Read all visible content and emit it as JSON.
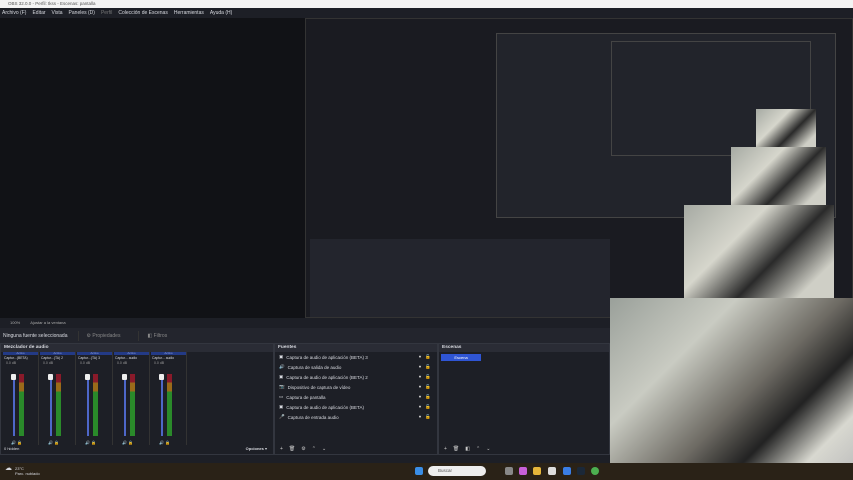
{
  "window_title": "OBS 32.0.0 - Perfil: tkss - Escenas: pantalla",
  "menu": [
    "Archivo (F)",
    "Editar",
    "Vista",
    "Paneles (D)",
    "Perfil",
    "Colección de Escenas",
    "Herramientas",
    "Ayuda (H)"
  ],
  "toolbar": {
    "zoom": "100%",
    "fit": "Ajustar a la ventana"
  },
  "context": {
    "no_source": "Ninguna fuente seleccionada",
    "properties": "Propiedades",
    "filters": "Filtros"
  },
  "mixer": {
    "title": "Mezclador de audio",
    "hidden": "0 hidden",
    "options": "Opciones",
    "channels": [
      {
        "active": "Activo",
        "name": "Captur...(BETA)",
        "db": "0.0 dB"
      },
      {
        "active": "Activo",
        "name": "Captur...(TA) 2",
        "db": "0.0 dB"
      },
      {
        "active": "Activo",
        "name": "Captur...(TA) 3",
        "db": "0.0 dB"
      },
      {
        "active": "Activo",
        "name": "Captur... audio",
        "db": "0.0 dB"
      },
      {
        "active": "Activo",
        "name": "Captur... audio",
        "db": "0.0 dB"
      }
    ]
  },
  "sources": {
    "title": "Fuentes",
    "items": [
      "Captura de audio de aplicación (BETA) 3",
      "Captura de salida de audio",
      "Captura de audio de aplicación (BETA) 2",
      "Dispositivo de captura de vídeo",
      "Captura de pantalla",
      "Captura de audio de aplicación (BETA)",
      "Captura de entrada audio"
    ]
  },
  "scenes": {
    "title": "Escenas",
    "items": [
      "Escena"
    ]
  },
  "taskbar": {
    "temp": "23°C",
    "weather": "Parc. nublado",
    "search": "Buscar"
  },
  "colors": {
    "accent": "#2f55d4",
    "bg": "#1d1f26"
  }
}
